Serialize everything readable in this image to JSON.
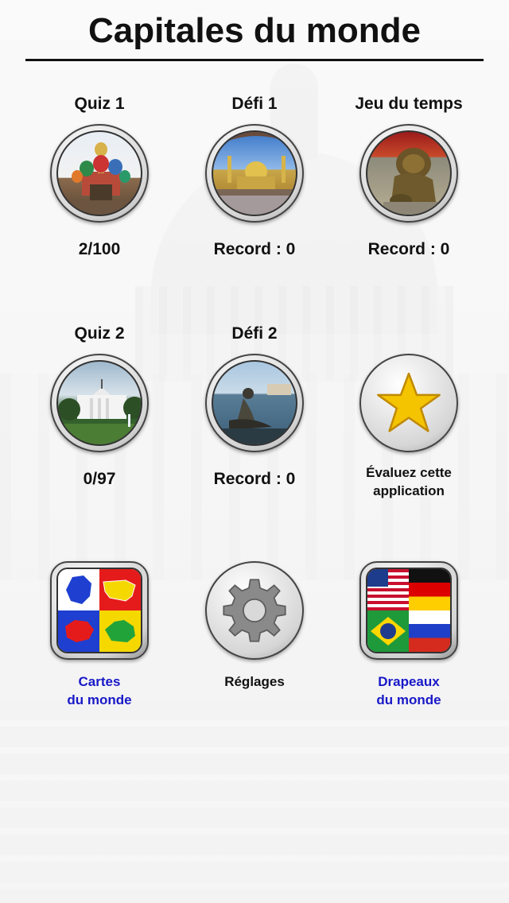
{
  "header": {
    "title": "Capitales du monde"
  },
  "row1": [
    {
      "label": "Quiz 1",
      "score": "2/100",
      "icon": "st-basil-cathedral-photo"
    },
    {
      "label": "Défi 1",
      "score": "Record : 0",
      "icon": "mosque-photo"
    },
    {
      "label": "Jeu du temps",
      "score": "Record : 0",
      "icon": "lion-statue-photo"
    }
  ],
  "row2": [
    {
      "label": "Quiz 2",
      "score": "0/97",
      "icon": "white-house-photo"
    },
    {
      "label": "Défi 2",
      "score": "Record : 0",
      "icon": "little-mermaid-photo"
    },
    {
      "label": "",
      "rate_line1": "Évaluez cette",
      "rate_line2": "application",
      "icon": "star-icon"
    }
  ],
  "row3": [
    {
      "line1": "Cartes",
      "line2": "du monde",
      "icon": "world-maps-icon"
    },
    {
      "line1": "Réglages",
      "icon": "gear-icon"
    },
    {
      "line1": "Drapeaux",
      "line2": "du monde",
      "icon": "world-flags-icon"
    }
  ],
  "colors": {
    "link": "#1818c8",
    "star": "#f5c400"
  }
}
